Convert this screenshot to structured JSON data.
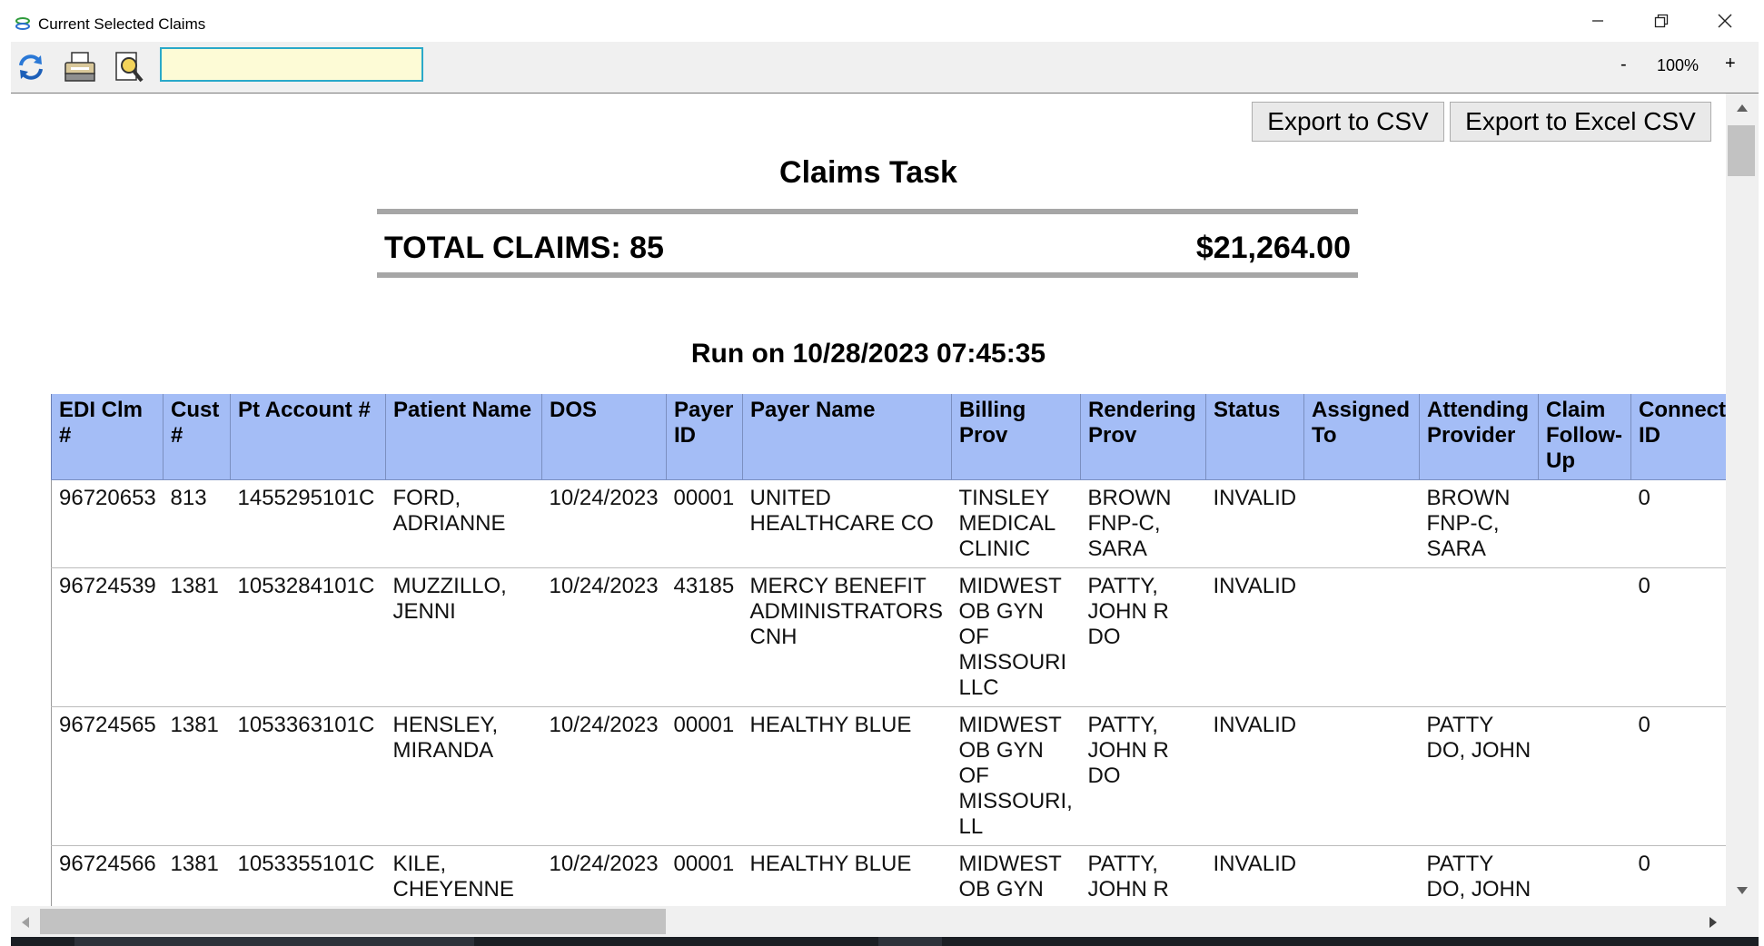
{
  "window": {
    "title": "Current Selected Claims",
    "icons": [
      "app-icon",
      "minimize-icon",
      "restore-icon",
      "close-icon"
    ]
  },
  "toolbar": {
    "icons": [
      "refresh-icon",
      "print-icon",
      "search-doc-icon"
    ],
    "search_value": "",
    "zoom_minus": "-",
    "zoom_value": "100%",
    "zoom_plus": "+"
  },
  "report": {
    "export_csv_label": "Export to CSV",
    "export_excel_label": "Export to Excel CSV",
    "title": "Claims Task",
    "total_label": "TOTAL CLAIMS: 85",
    "total_amount": "$21,264.00",
    "run_on": "Run on 10/28/2023 07:45:35"
  },
  "table": {
    "header_color": "#a4bdf6",
    "columns": [
      "EDI Clm #",
      "Cust #",
      "Pt Account #",
      "Patient Name",
      "DOS",
      "Payer ID",
      "Payer Name",
      "Billing Prov",
      "Rendering Prov",
      "Status",
      "Assigned To",
      "Attending Provider",
      "Claim Follow-Up",
      "Connect ID"
    ],
    "rows": [
      [
        "96720653",
        "813",
        "1455295101C",
        "FORD, ADRIANNE",
        "10/24/2023",
        "00001",
        "UNITED HEALTHCARE CO",
        "TINSLEY MEDICAL CLINIC",
        "BROWN FNP-C, SARA",
        "INVALID",
        "",
        "BROWN FNP-C, SARA",
        "",
        "0"
      ],
      [
        "96724539",
        "1381",
        "1053284101C",
        "MUZZILLO, JENNI",
        "10/24/2023",
        "43185",
        "MERCY BENEFIT ADMINISTRATORS CNH",
        "MIDWEST OB GYN OF MISSOURI LLC",
        "PATTY, JOHN R DO",
        "INVALID",
        "",
        "",
        "",
        "0"
      ],
      [
        "96724565",
        "1381",
        "1053363101C",
        "HENSLEY, MIRANDA",
        "10/24/2023",
        "00001",
        "HEALTHY BLUE",
        "MIDWEST OB GYN OF MISSOURI, LL",
        "PATTY, JOHN R DO",
        "INVALID",
        "",
        "PATTY DO, JOHN",
        "",
        "0"
      ],
      [
        "96724566",
        "1381",
        "1053355101C",
        "KILE, CHEYENNE",
        "10/24/2023",
        "00001",
        "HEALTHY BLUE",
        "MIDWEST OB GYN OF MISSOURI, LL",
        "PATTY, JOHN R DO",
        "INVALID",
        "",
        "PATTY DO, JOHN",
        "",
        "0"
      ]
    ]
  },
  "scrollbars": {
    "icons": [
      "scroll-up-icon",
      "scroll-down-icon",
      "scroll-left-icon",
      "scroll-right-icon"
    ]
  }
}
